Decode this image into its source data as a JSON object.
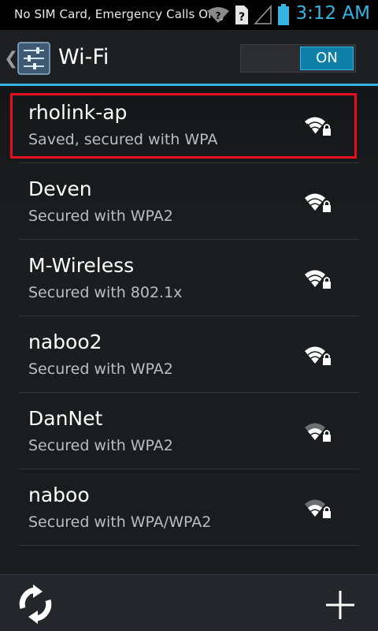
{
  "status_bar": {
    "carrier_text": "No SIM Card, Emergency Calls Only",
    "time": "3:12 AM",
    "icons": [
      "wifi-unknown-icon",
      "sim-unknown-icon",
      "no-signal-icon",
      "battery-icon"
    ],
    "clock_color": "#33b5e5"
  },
  "action_bar": {
    "title": "Wi-Fi",
    "toggle_label": "ON",
    "accent_color": "#33b5e5"
  },
  "networks": [
    {
      "name": "rholink-ap",
      "status": "Saved, secured with WPA",
      "signal": "strong"
    },
    {
      "name": "Deven",
      "status": "Secured with WPA2",
      "signal": "strong"
    },
    {
      "name": "M-Wireless",
      "status": "Secured with 802.1x",
      "signal": "strong"
    },
    {
      "name": "naboo2",
      "status": "Secured with WPA2",
      "signal": "strong"
    },
    {
      "name": "DanNet",
      "status": "Secured with WPA2",
      "signal": "weak"
    },
    {
      "name": "naboo",
      "status": "Secured with WPA/WPA2",
      "signal": "weak"
    }
  ],
  "highlight_color": "#e3101d",
  "bottom_bar": {
    "icons": [
      "scan-icon",
      "add-network-icon"
    ]
  }
}
